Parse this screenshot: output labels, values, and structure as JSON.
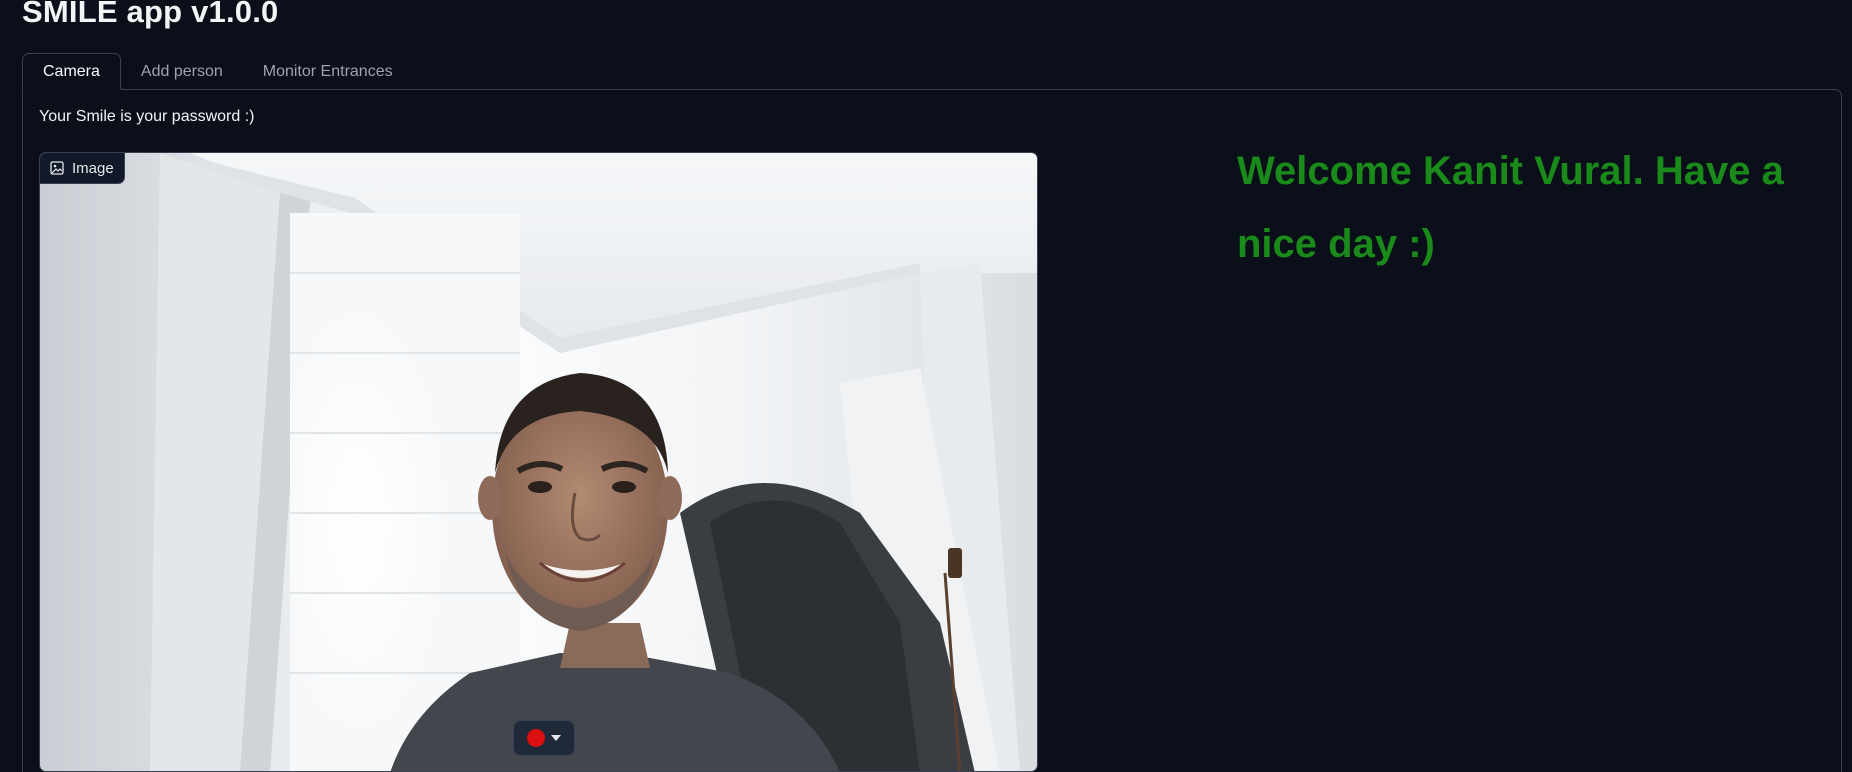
{
  "app": {
    "title": "SMILE app v1.0.0"
  },
  "tabs": [
    {
      "label": "Camera",
      "selected": true
    },
    {
      "label": "Add person",
      "selected": false
    },
    {
      "label": "Monitor Entrances",
      "selected": false
    }
  ],
  "camera_tab": {
    "description": "Your Smile is your password :)",
    "image_component": {
      "label": "Image",
      "label_icon": "image-icon",
      "record_button_icon": "record-dot-icon",
      "record_menu_icon": "chevron-down-icon"
    },
    "welcome_message": "Welcome Kanit Vural. Have a nice day :)"
  },
  "colors": {
    "background": "#0b0f19",
    "border": "#374151",
    "welcome_text": "#1a8a1a",
    "record": "#dc1010"
  }
}
